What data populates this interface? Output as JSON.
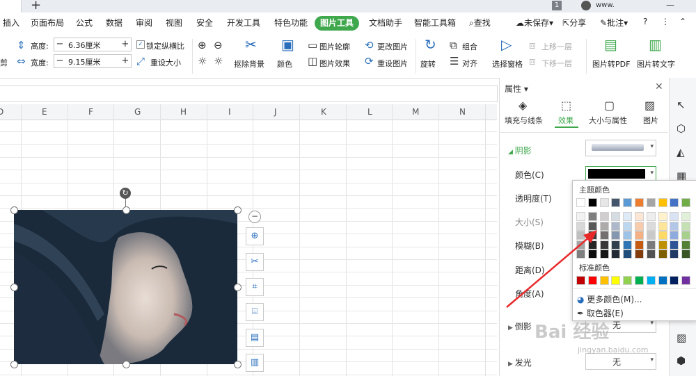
{
  "topbar": {
    "page_badge": "1",
    "username": "www.",
    "window_buttons": [
      "—",
      "⋮",
      "—"
    ]
  },
  "menu": {
    "items": [
      "插入",
      "页面布局",
      "公式",
      "数据",
      "审阅",
      "视图",
      "安全",
      "开发工具",
      "特色功能",
      "图片工具",
      "文档助手",
      "智能工具箱"
    ],
    "active": "图片工具",
    "search": "查找",
    "unsaved": "未保存",
    "share": "分享",
    "comment": "批注",
    "help": "?"
  },
  "ribbon": {
    "cut_label": "剪",
    "height_label": "高度:",
    "height_value": "6.36厘米",
    "width_label": "宽度:",
    "width_value": "9.15厘米",
    "lock_ratio": "锁定纵横比",
    "reset_size": "重设大小",
    "remove_bg": "抠除背景",
    "color": "颜色",
    "outline": "图片轮廓",
    "effects": "图片效果",
    "change_pic": "更改图片",
    "reset_pic": "重设图片",
    "rotate": "旋转",
    "group": "组合",
    "align": "对齐",
    "select_pane": "选择窗格",
    "bring_forward": "上移一层",
    "send_backward": "下移一层",
    "pic_to_pdf": "图片转PDF",
    "pic_to_text": "图片转文字"
  },
  "sheet": {
    "columns": [
      "D",
      "E",
      "F",
      "G",
      "H",
      "I",
      "J",
      "K",
      "L",
      "M",
      "N"
    ]
  },
  "panel": {
    "title": "属性",
    "tabs": [
      "填充与线条",
      "效果",
      "大小与属性",
      "图片"
    ],
    "active_tab": "效果",
    "section_shadow": "阴影",
    "rows": [
      "颜色(C)",
      "透明度(T)",
      "大小(S)",
      "模糊(B)",
      "距离(D)",
      "角度(A)"
    ],
    "reflection": "倒影",
    "glow": "发光",
    "none": "无",
    "shadow_color": "#000000"
  },
  "color_popup": {
    "theme_title": "主题颜色",
    "standard_title": "标准颜色",
    "more_colors": "更多颜色(M)...",
    "eyedropper": "取色器(E)",
    "theme_top": [
      "#ffffff",
      "#000000",
      "#e7e6e6",
      "#44546a",
      "#5b9bd5",
      "#ed7d31",
      "#a5a5a5",
      "#ffc000",
      "#4472c4",
      "#70ad47"
    ],
    "theme_shades": [
      [
        "#f2f2f2",
        "#7f7f7f",
        "#d0cece",
        "#d6dce4",
        "#deebf6",
        "#fbe5d5",
        "#ededed",
        "#fff2cc",
        "#dae3f3",
        "#e2efd9"
      ],
      [
        "#d8d8d8",
        "#595959",
        "#aeaaaa",
        "#adb9ca",
        "#bdd7ee",
        "#f8cbad",
        "#dbdbdb",
        "#fee599",
        "#b4c6e7",
        "#c5e0b3"
      ],
      [
        "#bfbfbf",
        "#3f3f3f",
        "#757070",
        "#8496b0",
        "#9dc3e6",
        "#f4b183",
        "#c9c9c9",
        "#ffd965",
        "#8faadc",
        "#a8d08d"
      ],
      [
        "#a5a5a5",
        "#262626",
        "#3a3838",
        "#323f4f",
        "#2e75b5",
        "#c55a11",
        "#7b7b7b",
        "#bf9000",
        "#2f5496",
        "#538135"
      ],
      [
        "#7f7f7f",
        "#0c0c0c",
        "#171616",
        "#222a35",
        "#1e4e79",
        "#833c0b",
        "#525252",
        "#7f6000",
        "#1f3864",
        "#375623"
      ]
    ],
    "standard": [
      "#c00000",
      "#ff0000",
      "#ffc000",
      "#ffff00",
      "#92d050",
      "#00b050",
      "#00b0f0",
      "#0070c0",
      "#002060",
      "#7030a0"
    ]
  },
  "watermark": {
    "text": "Bai 经验",
    "url": "jingyan.baidu.com"
  }
}
